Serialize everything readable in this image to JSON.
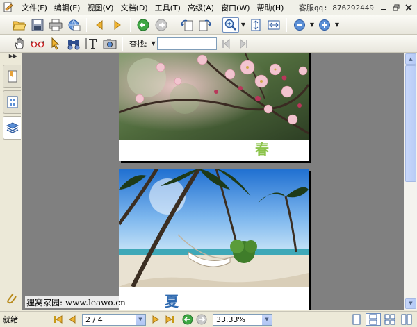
{
  "menubar": {
    "items": [
      "文件(F)",
      "编辑(E)",
      "视图(V)",
      "文档(D)",
      "工具(T)",
      "高级(A)",
      "窗口(W)",
      "帮助(H)"
    ],
    "support": "客服qq: 876292449"
  },
  "toolbar2": {
    "find_label": "查找:",
    "find_value": ""
  },
  "pages": [
    {
      "caption": "春"
    },
    {
      "caption": "夏"
    }
  ],
  "status": {
    "ready": "就绪",
    "page_value": "2 / 4",
    "zoom_value": "33.33%"
  },
  "watermark": "狸窝家园: www.leawo.cn",
  "colors": {
    "accent": "#316ac5",
    "viewport": "#808080",
    "chrome": "#ece9d8"
  }
}
